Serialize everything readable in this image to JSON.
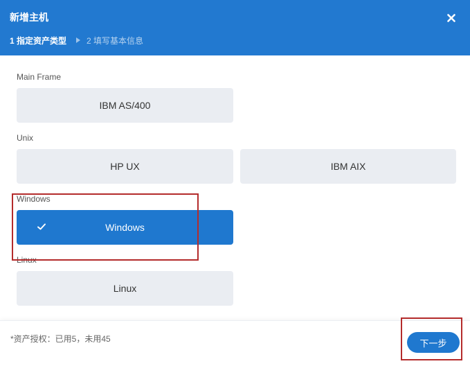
{
  "dialog": {
    "title": "新增主机",
    "steps": [
      {
        "label": "1 指定资产类型",
        "active": true
      },
      {
        "label": "2 填写基本信息",
        "active": false
      }
    ]
  },
  "sections": [
    {
      "label": "Main Frame",
      "options": [
        "IBM AS/400"
      ]
    },
    {
      "label": "Unix",
      "options": [
        "HP UX",
        "IBM AIX"
      ]
    },
    {
      "label": "Windows",
      "options": [
        "Windows"
      ],
      "selected": "Windows"
    },
    {
      "label": "Linux",
      "options": [
        "Linux"
      ]
    }
  ],
  "footer": {
    "license_text": "*资产授权：已用5，未用45",
    "next_label": "下一步"
  },
  "colors": {
    "primary": "#1f78cf",
    "header": "#2279d0",
    "option_bg": "#eaedf2",
    "annotation": "#b42b2b"
  },
  "icons": {
    "close": "close-icon",
    "step_arrow": "caret-right-icon",
    "selected_check": "check-icon"
  }
}
